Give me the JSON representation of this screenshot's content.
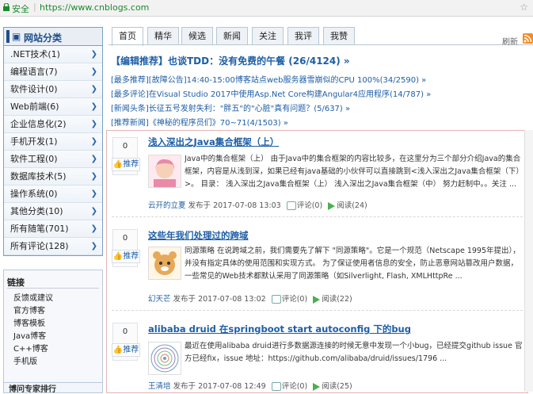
{
  "browser": {
    "secure_label": "安全",
    "url": "https://www.cnblogs.com"
  },
  "sidebar": {
    "category_title": "网站分类",
    "categories": [
      {
        "label": ".NET技术(1)"
      },
      {
        "label": "编程语言(7)"
      },
      {
        "label": "软件设计(0)"
      },
      {
        "label": "Web前端(6)"
      },
      {
        "label": "企业信息化(2)"
      },
      {
        "label": "手机开发(1)"
      },
      {
        "label": "软件工程(0)"
      },
      {
        "label": "数据库技术(5)"
      },
      {
        "label": "操作系统(0)"
      },
      {
        "label": "其他分类(10)"
      },
      {
        "label": "所有随笔(701)"
      },
      {
        "label": "所有评论(128)"
      }
    ],
    "links_title": "链接",
    "links": [
      "反馈或建议",
      "官方博客",
      "博客模板",
      "Java博客",
      "C++博客",
      "手机版"
    ],
    "bottom_title": "博问专家排行"
  },
  "tabs": [
    {
      "label": "首页"
    },
    {
      "label": "精华"
    },
    {
      "label": "候选"
    },
    {
      "label": "新闻"
    },
    {
      "label": "关注"
    },
    {
      "label": "我评"
    },
    {
      "label": "我赞"
    }
  ],
  "refresh_label": "刷新",
  "headlines": {
    "main": "【编辑推荐】也谈TDD：没有免费的午餐 (26/4124) »",
    "items": [
      "[最多推荐][故障公告]14:40-15:00博客站点web服务器雪崩似的CPU 100%(34/2590) »",
      "[最多评论]在Visual Studio 2017中使用Asp.Net Core构建Angular4应用程序(14/787) »",
      "[新闻头条]长征五号发射失利：\"胖五\"的\"心脏\"真有问题？(5/637) »",
      "[推荐新闻]《神秘的程序员们》70~71(4/1503) »"
    ]
  },
  "posts": [
    {
      "digg": "0",
      "digg_label": "推荐",
      "title": "浅入深出之Java集合框架（上）",
      "summary": "Java中的集合框架（上） 由于Java中的集合框架的内容比较多，在这里分为三个部分介绍Java的集合框架，内容是从浅到深，如果已经有java基础的小伙伴可以直接跳到<浅入深出之Java集合框架（下）>。 目录： 浅入深出之Java集合框架（上） 浅入深出之Java集合框架（中） 努力赶制中。。关注 ...",
      "author": "云开的立夏",
      "posted": "发布于 2017-07-08 13:03",
      "comments": "评论(0)",
      "reads": "阅读(24)"
    },
    {
      "digg": "0",
      "digg_label": "推荐",
      "title": "这些年我们处理过的跨域",
      "summary": "同源策略 在说跨域之前，我们需要先了解下 \"同源策略\"。它是一个规范（Netscape 1995年提出），并没有指定具体的使用范围和实现方式。 为了保证使用者信息的安全，防止恶意网站篡改用户数据，一些常见的Web技术都默认采用了同源策略（如Silverlight, Flash, XMLHttpRe ...",
      "author": "幻天芒",
      "posted": "发布于 2017-07-08 13:02",
      "comments": "评论(0)",
      "reads": "阅读(22)"
    },
    {
      "digg": "0",
      "digg_label": "推荐",
      "title": "alibaba druid 在springboot start autoconfig 下的bug",
      "summary": "最近在使用alibaba druid进行多数据源连接的时候无意中发现一个小bug，已经提交github issue 官方已经fix，issue 地址：https://github.com/alibaba/druid/issues/1796 ...",
      "author": "王清培",
      "posted": "发布于 2017-07-08 12:49",
      "comments": "评论(0)",
      "reads": "阅读(25)"
    }
  ]
}
